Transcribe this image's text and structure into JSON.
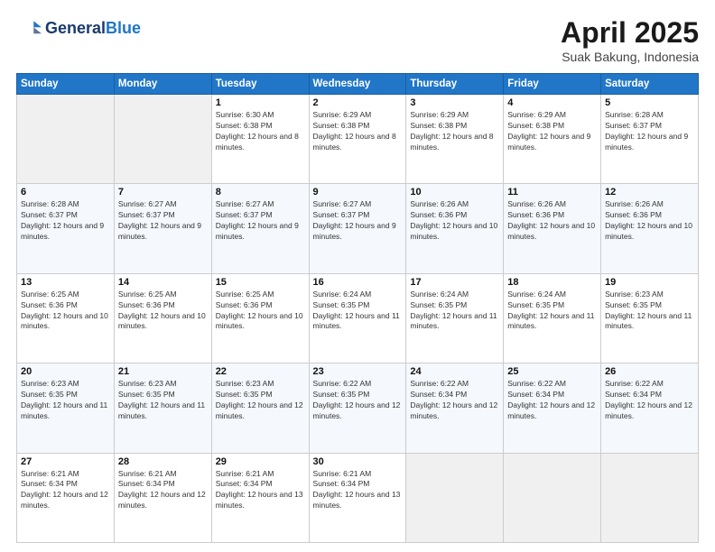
{
  "header": {
    "logo_line1": "General",
    "logo_line2": "Blue",
    "month_year": "April 2025",
    "location": "Suak Bakung, Indonesia"
  },
  "weekdays": [
    "Sunday",
    "Monday",
    "Tuesday",
    "Wednesday",
    "Thursday",
    "Friday",
    "Saturday"
  ],
  "weeks": [
    [
      {
        "day": "",
        "info": ""
      },
      {
        "day": "",
        "info": ""
      },
      {
        "day": "1",
        "info": "Sunrise: 6:30 AM\nSunset: 6:38 PM\nDaylight: 12 hours and 8 minutes."
      },
      {
        "day": "2",
        "info": "Sunrise: 6:29 AM\nSunset: 6:38 PM\nDaylight: 12 hours and 8 minutes."
      },
      {
        "day": "3",
        "info": "Sunrise: 6:29 AM\nSunset: 6:38 PM\nDaylight: 12 hours and 8 minutes."
      },
      {
        "day": "4",
        "info": "Sunrise: 6:29 AM\nSunset: 6:38 PM\nDaylight: 12 hours and 9 minutes."
      },
      {
        "day": "5",
        "info": "Sunrise: 6:28 AM\nSunset: 6:37 PM\nDaylight: 12 hours and 9 minutes."
      }
    ],
    [
      {
        "day": "6",
        "info": "Sunrise: 6:28 AM\nSunset: 6:37 PM\nDaylight: 12 hours and 9 minutes."
      },
      {
        "day": "7",
        "info": "Sunrise: 6:27 AM\nSunset: 6:37 PM\nDaylight: 12 hours and 9 minutes."
      },
      {
        "day": "8",
        "info": "Sunrise: 6:27 AM\nSunset: 6:37 PM\nDaylight: 12 hours and 9 minutes."
      },
      {
        "day": "9",
        "info": "Sunrise: 6:27 AM\nSunset: 6:37 PM\nDaylight: 12 hours and 9 minutes."
      },
      {
        "day": "10",
        "info": "Sunrise: 6:26 AM\nSunset: 6:36 PM\nDaylight: 12 hours and 10 minutes."
      },
      {
        "day": "11",
        "info": "Sunrise: 6:26 AM\nSunset: 6:36 PM\nDaylight: 12 hours and 10 minutes."
      },
      {
        "day": "12",
        "info": "Sunrise: 6:26 AM\nSunset: 6:36 PM\nDaylight: 12 hours and 10 minutes."
      }
    ],
    [
      {
        "day": "13",
        "info": "Sunrise: 6:25 AM\nSunset: 6:36 PM\nDaylight: 12 hours and 10 minutes."
      },
      {
        "day": "14",
        "info": "Sunrise: 6:25 AM\nSunset: 6:36 PM\nDaylight: 12 hours and 10 minutes."
      },
      {
        "day": "15",
        "info": "Sunrise: 6:25 AM\nSunset: 6:36 PM\nDaylight: 12 hours and 10 minutes."
      },
      {
        "day": "16",
        "info": "Sunrise: 6:24 AM\nSunset: 6:35 PM\nDaylight: 12 hours and 11 minutes."
      },
      {
        "day": "17",
        "info": "Sunrise: 6:24 AM\nSunset: 6:35 PM\nDaylight: 12 hours and 11 minutes."
      },
      {
        "day": "18",
        "info": "Sunrise: 6:24 AM\nSunset: 6:35 PM\nDaylight: 12 hours and 11 minutes."
      },
      {
        "day": "19",
        "info": "Sunrise: 6:23 AM\nSunset: 6:35 PM\nDaylight: 12 hours and 11 minutes."
      }
    ],
    [
      {
        "day": "20",
        "info": "Sunrise: 6:23 AM\nSunset: 6:35 PM\nDaylight: 12 hours and 11 minutes."
      },
      {
        "day": "21",
        "info": "Sunrise: 6:23 AM\nSunset: 6:35 PM\nDaylight: 12 hours and 11 minutes."
      },
      {
        "day": "22",
        "info": "Sunrise: 6:23 AM\nSunset: 6:35 PM\nDaylight: 12 hours and 12 minutes."
      },
      {
        "day": "23",
        "info": "Sunrise: 6:22 AM\nSunset: 6:35 PM\nDaylight: 12 hours and 12 minutes."
      },
      {
        "day": "24",
        "info": "Sunrise: 6:22 AM\nSunset: 6:34 PM\nDaylight: 12 hours and 12 minutes."
      },
      {
        "day": "25",
        "info": "Sunrise: 6:22 AM\nSunset: 6:34 PM\nDaylight: 12 hours and 12 minutes."
      },
      {
        "day": "26",
        "info": "Sunrise: 6:22 AM\nSunset: 6:34 PM\nDaylight: 12 hours and 12 minutes."
      }
    ],
    [
      {
        "day": "27",
        "info": "Sunrise: 6:21 AM\nSunset: 6:34 PM\nDaylight: 12 hours and 12 minutes."
      },
      {
        "day": "28",
        "info": "Sunrise: 6:21 AM\nSunset: 6:34 PM\nDaylight: 12 hours and 12 minutes."
      },
      {
        "day": "29",
        "info": "Sunrise: 6:21 AM\nSunset: 6:34 PM\nDaylight: 12 hours and 13 minutes."
      },
      {
        "day": "30",
        "info": "Sunrise: 6:21 AM\nSunset: 6:34 PM\nDaylight: 12 hours and 13 minutes."
      },
      {
        "day": "",
        "info": ""
      },
      {
        "day": "",
        "info": ""
      },
      {
        "day": "",
        "info": ""
      }
    ]
  ]
}
